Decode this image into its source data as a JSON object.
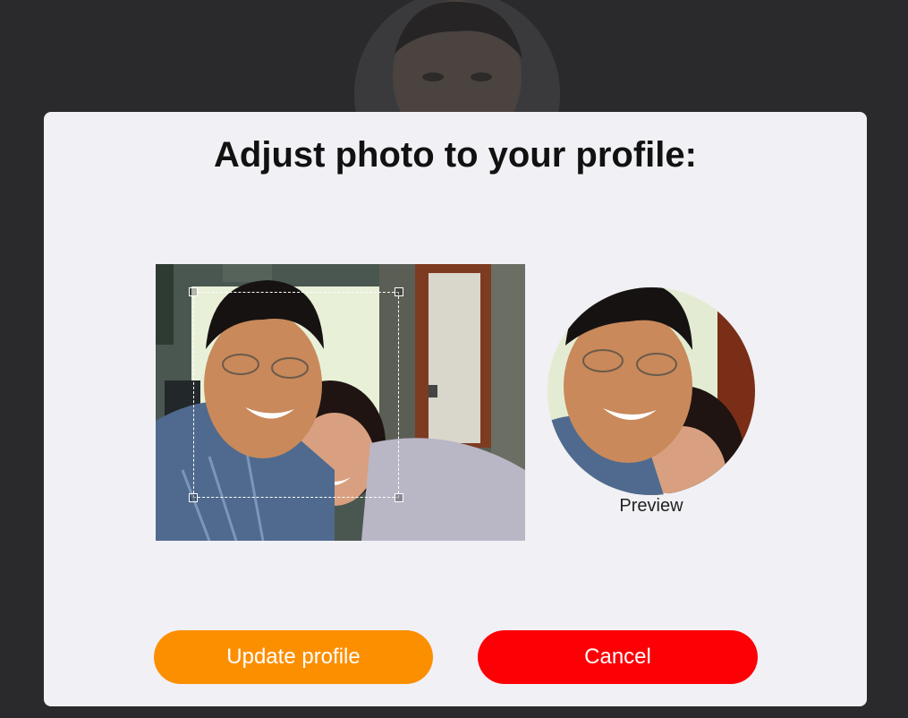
{
  "modal": {
    "title": "Adjust photo to your profile:",
    "preview_label": "Preview"
  },
  "actions": {
    "update_label": "Update profile",
    "cancel_label": "Cancel"
  },
  "colors": {
    "update_button": "#fc8f00",
    "cancel_button": "#fc0006",
    "modal_background": "#f1f0f5",
    "overlay": "#2a2a2c"
  },
  "icons": {
    "photo": "photo-image",
    "crop_handle": "crop-handle-icon"
  }
}
